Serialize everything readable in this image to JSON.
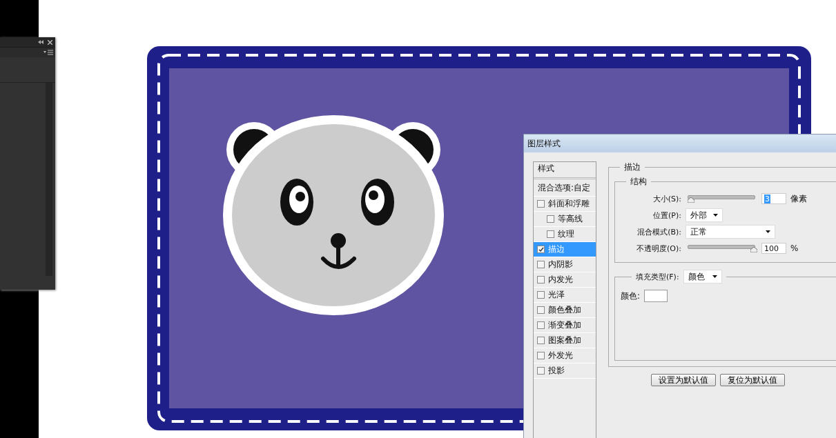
{
  "dialog": {
    "title": "图层样式",
    "styles_header": "样式",
    "blend_options": "混合选项:自定",
    "style_items": [
      {
        "label": "斜面和浮雕",
        "checked": false,
        "selected": false,
        "children": [
          {
            "label": "等高线",
            "checked": false,
            "selected": false
          },
          {
            "label": "纹理",
            "checked": false,
            "selected": false
          }
        ]
      },
      {
        "label": "描边",
        "checked": true,
        "selected": true
      },
      {
        "label": "内阴影",
        "checked": false,
        "selected": false
      },
      {
        "label": "内发光",
        "checked": false,
        "selected": false
      },
      {
        "label": "光泽",
        "checked": false,
        "selected": false
      },
      {
        "label": "颜色叠加",
        "checked": false,
        "selected": false
      },
      {
        "label": "渐变叠加",
        "checked": false,
        "selected": false
      },
      {
        "label": "图案叠加",
        "checked": false,
        "selected": false
      },
      {
        "label": "外发光",
        "checked": false,
        "selected": false
      },
      {
        "label": "投影",
        "checked": false,
        "selected": false
      }
    ],
    "section_title": "描边",
    "structure": {
      "title": "结构",
      "size": {
        "label": "大小(S):",
        "level": 0.03,
        "value": "3",
        "unit": "像素"
      },
      "position": {
        "label": "位置(P):",
        "value": "外部"
      },
      "blend_mode": {
        "label": "混合模式(B):",
        "value": "正常"
      },
      "opacity": {
        "label": "不透明度(O):",
        "level": 1,
        "value": "100",
        "unit": "%"
      }
    },
    "fill": {
      "type_label": "填充类型(F):",
      "type_value": "颜色",
      "color_label": "颜色:"
    },
    "buttons": [
      "设置为默认值",
      "复位为默认值"
    ]
  }
}
